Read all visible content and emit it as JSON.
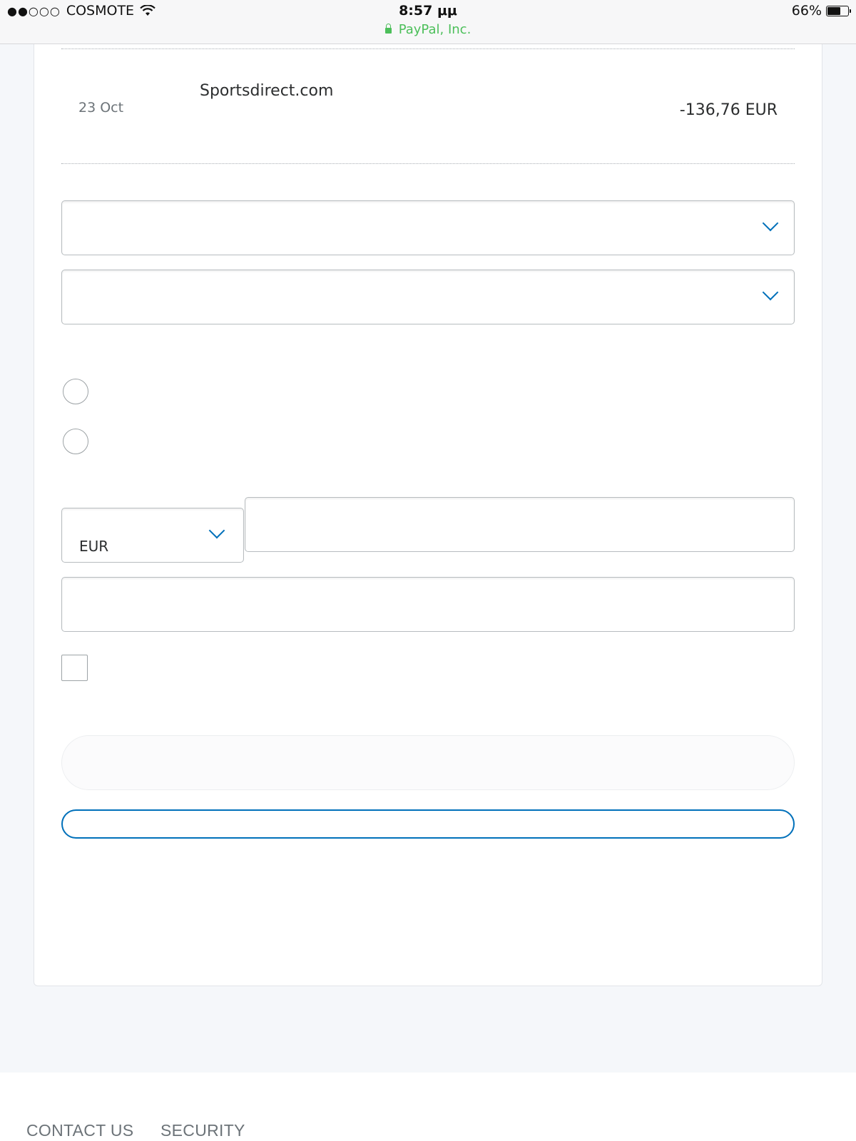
{
  "status_bar": {
    "signal": "●●○○○",
    "carrier": "COSMOTE",
    "time": "8:57 μμ",
    "site": "PayPal, Inc.",
    "battery_text": "66%",
    "battery_level": 0.66
  },
  "transaction": {
    "date": "23 Oct",
    "merchant": "Sportsdirect.com",
    "amount": "-136,76 EUR"
  },
  "form": {
    "currency_value": "EUR"
  },
  "footer": {
    "links": [
      "CONTACT US",
      "SECURITY"
    ]
  },
  "colors": {
    "accent": "#0070ba",
    "secure_green": "#4cbf5a",
    "page_background": "#f5f7fa"
  }
}
